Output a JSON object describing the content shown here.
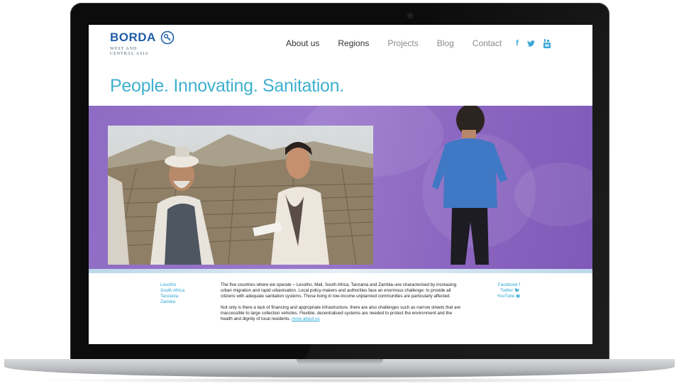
{
  "site": {
    "logo_text": "BORDA",
    "logo_sub": "WEST AND CENTRAL ASIA",
    "tagline": "People. Innovating. Sanitation."
  },
  "nav": {
    "items": [
      {
        "label": "About us"
      },
      {
        "label": "Regions"
      },
      {
        "label": "Projects"
      },
      {
        "label": "Blog"
      },
      {
        "label": "Contact"
      }
    ],
    "social_icons": [
      "facebook-icon",
      "twitter-icon",
      "youtube-icon"
    ],
    "social_glyphs": [
      "f",
      "t",
      "yt"
    ]
  },
  "regions": [
    "Lesotho",
    "South Africa",
    "Tanzania",
    "Zambia"
  ],
  "body": {
    "paragraph1": "The five countries where we operate – Lesotho, Mali, South Africa, Tanzania and Zambia–are characterised by increasing urban migration and rapid urbanisation. Local policy-makers and authorities face an enormous challenge: to provide all citizens with adequate sanitation systems. Those living in low-income unplanned communities are particularly affected.",
    "paragraph2": "Not only is there a lack of financing and appropriate infrastructure, there are also challenges such as narrow streets that are inaccessible to large collection vehicles. Flexible, decentralised systems are needed to protect the environment and the health and dignity of local residents.",
    "more_link": "more about us"
  },
  "social_links": [
    {
      "label": "Facebook",
      "icon": "facebook-icon",
      "glyph": "f"
    },
    {
      "label": "Twitter",
      "icon": "twitter-icon",
      "glyph": "🐦"
    },
    {
      "label": "YouTube",
      "icon": "youtube-icon",
      "glyph": "▣"
    }
  ],
  "colors": {
    "brand_blue": "#1e5ea8",
    "accent_teal": "#3fb0cf",
    "link_blue": "#2aa7d5",
    "hero_purple": "#8e6cc4"
  }
}
